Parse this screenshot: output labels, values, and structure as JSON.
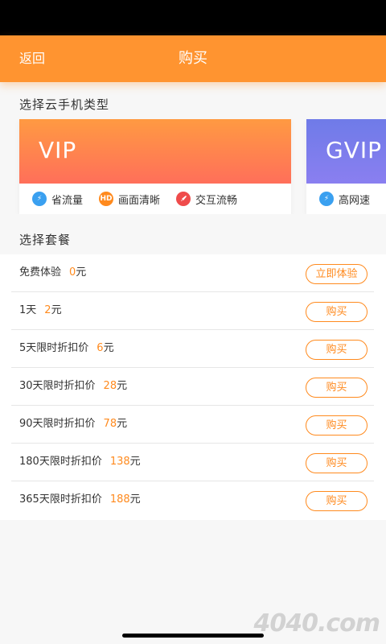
{
  "nav": {
    "back_label": "返回",
    "title": "购买"
  },
  "sections": {
    "phone_type_title": "选择云手机类型",
    "plan_title": "选择套餐"
  },
  "cards": [
    {
      "name": "VIP",
      "features": [
        {
          "icon": "bolt-icon",
          "color": "#3aa0f0",
          "label": "省流量"
        },
        {
          "icon": "hd-icon",
          "color": "#ff8a1e",
          "label": "画面清晰"
        },
        {
          "icon": "rocket-icon",
          "color": "#ef4b4b",
          "label": "交互流畅"
        }
      ]
    },
    {
      "name": "GVIP",
      "features": [
        {
          "icon": "bolt-icon",
          "color": "#3aa0f0",
          "label": "高网速"
        }
      ]
    }
  ],
  "plans": [
    {
      "name": "免费体验",
      "price": "0",
      "unit": "元",
      "button": "立即体验"
    },
    {
      "name": "1天",
      "price": "2",
      "unit": "元",
      "button": "购买"
    },
    {
      "name": "5天限时折扣价",
      "price": "6",
      "unit": "元",
      "button": "购买"
    },
    {
      "name": "30天限时折扣价",
      "price": "28",
      "unit": "元",
      "button": "购买"
    },
    {
      "name": "90天限时折扣价",
      "price": "78",
      "unit": "元",
      "button": "购买"
    },
    {
      "name": "180天限时折扣价",
      "price": "138",
      "unit": "元",
      "button": "购买"
    },
    {
      "name": "365天限时折扣价",
      "price": "188",
      "unit": "元",
      "button": "购买"
    }
  ],
  "watermark": "4040.com",
  "colors": {
    "accent": "#ff9430",
    "price": "#ff8a1e"
  }
}
